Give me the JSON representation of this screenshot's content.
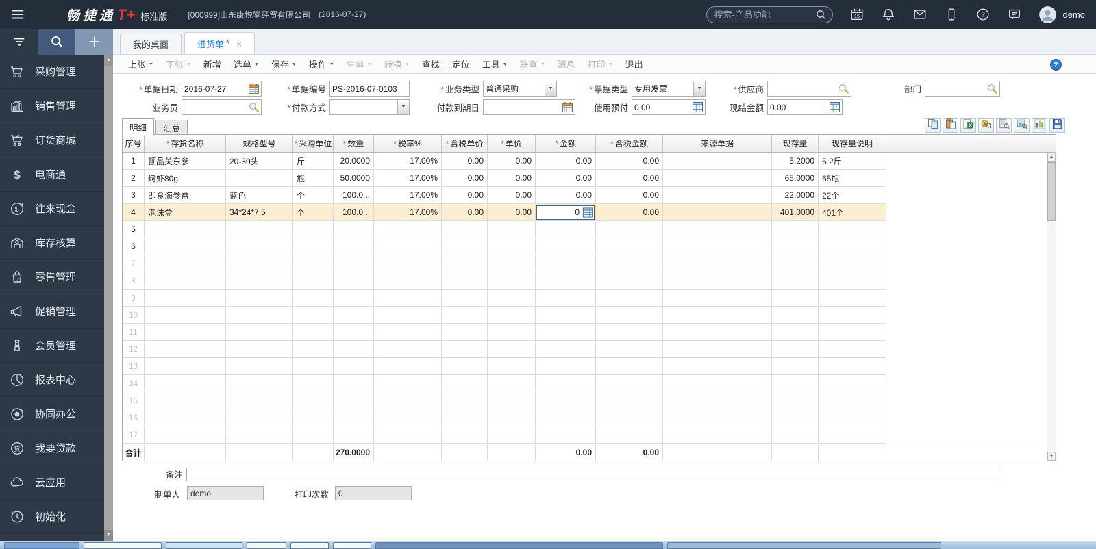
{
  "topbar": {
    "logo_cn": "畅捷通",
    "logo_plus": "T+",
    "edition": "标准版",
    "company": "[000999]山东康悦堂经贸有限公司",
    "date": "(2016-07-27)",
    "search_placeholder": "搜索-产品功能",
    "icons": [
      "calendar",
      "bell",
      "mail",
      "mobile",
      "help",
      "chat"
    ],
    "user": "demo"
  },
  "sidebar": {
    "items": [
      {
        "key": "purchase",
        "icon": "cart",
        "label": "采购管理"
      },
      {
        "key": "sales",
        "icon": "chart",
        "label": "销售管理"
      },
      {
        "key": "mall",
        "icon": "mallcart",
        "label": "订货商城"
      },
      {
        "key": "ecommerce",
        "icon": "ecommerce",
        "label": "电商通"
      },
      {
        "key": "cash",
        "icon": "coin",
        "label": "往来现金"
      },
      {
        "key": "inventory",
        "icon": "warehouse",
        "label": "库存核算"
      },
      {
        "key": "retail",
        "icon": "bag",
        "label": "零售管理"
      },
      {
        "key": "promotion",
        "icon": "megaphone",
        "label": "促销管理"
      },
      {
        "key": "member",
        "icon": "badge",
        "label": "会员管理"
      },
      {
        "key": "report",
        "icon": "pie",
        "label": "报表中心"
      },
      {
        "key": "collab",
        "icon": "target",
        "label": "协同办公"
      },
      {
        "key": "loan",
        "icon": "loan",
        "label": "我要贷款"
      },
      {
        "key": "cloud",
        "icon": "cloud",
        "label": "云应用"
      },
      {
        "key": "init",
        "icon": "clock",
        "label": "初始化"
      }
    ]
  },
  "tabs": [
    {
      "label": "我的桌面",
      "marker": ""
    },
    {
      "label": "进货单",
      "marker": "*"
    }
  ],
  "toolbar": {
    "items": [
      {
        "key": "prev",
        "label": "上张",
        "caret": true,
        "enabled": true
      },
      {
        "key": "next",
        "label": "下张",
        "caret": true,
        "enabled": false
      },
      {
        "key": "add",
        "label": "新增",
        "caret": false,
        "enabled": true
      },
      {
        "key": "select-bill",
        "label": "选单",
        "caret": true,
        "enabled": true
      },
      {
        "key": "save",
        "label": "保存",
        "caret": true,
        "enabled": true
      },
      {
        "key": "action",
        "label": "操作",
        "caret": true,
        "enabled": true
      },
      {
        "key": "generate",
        "label": "生单",
        "caret": true,
        "enabled": false
      },
      {
        "key": "convert",
        "label": "转换",
        "caret": true,
        "enabled": false
      },
      {
        "key": "find",
        "label": "查找",
        "caret": false,
        "enabled": true
      },
      {
        "key": "locate",
        "label": "定位",
        "caret": false,
        "enabled": true
      },
      {
        "key": "tools",
        "label": "工具",
        "caret": true,
        "enabled": true
      },
      {
        "key": "linkquery",
        "label": "联查",
        "caret": true,
        "enabled": false
      },
      {
        "key": "message",
        "label": "消息",
        "caret": false,
        "enabled": false
      },
      {
        "key": "print",
        "label": "打印",
        "caret": true,
        "enabled": false
      },
      {
        "key": "exit",
        "label": "退出",
        "caret": false,
        "enabled": true
      }
    ]
  },
  "required_marker": "*",
  "form": {
    "fields": [
      {
        "key": "bill-date",
        "label": "单据日期",
        "required": true,
        "value": "2016-07-27",
        "icon": "calendar"
      },
      {
        "key": "bill-no",
        "label": "单据编号",
        "required": true,
        "value": "PS-2016-07-0103",
        "icon": "none"
      },
      {
        "key": "biz-type",
        "label": "业务类型",
        "required": true,
        "value": "普通采购",
        "icon": "dropdown"
      },
      {
        "key": "invoice-type",
        "label": "票据类型",
        "required": true,
        "value": "专用发票",
        "icon": "dropdown"
      },
      {
        "key": "supplier",
        "label": "供应商",
        "required": true,
        "value": "",
        "icon": "magnifier"
      },
      {
        "key": "department",
        "label": "部门",
        "required": false,
        "value": "",
        "icon": "magnifier"
      },
      {
        "key": "salesman",
        "label": "业务员",
        "required": false,
        "value": "",
        "icon": "magnifier"
      },
      {
        "key": "pay-method",
        "label": "付款方式",
        "required": true,
        "value": "",
        "icon": "dropdown"
      },
      {
        "key": "pay-due",
        "label": "付款到期日",
        "required": false,
        "value": "",
        "icon": "calendar"
      },
      {
        "key": "prepaid",
        "label": "使用预付",
        "required": false,
        "value": "0.00",
        "icon": "calc"
      },
      {
        "key": "cash-amount",
        "label": "现结金额",
        "required": false,
        "value": "0.00",
        "icon": "calc"
      }
    ]
  },
  "detail_tabs": [
    {
      "label": "明细",
      "active": true
    },
    {
      "label": "汇总",
      "active": false
    }
  ],
  "grid_toolbar": {
    "icons": [
      "copy",
      "paste",
      "excel",
      "find-money",
      "doc-preview",
      "pic-preview",
      "chart",
      "save"
    ]
  },
  "grid": {
    "columns": [
      {
        "key": "seq",
        "label": "序号",
        "required": false
      },
      {
        "key": "item-name",
        "label": "存货名称",
        "required": true
      },
      {
        "key": "spec",
        "label": "规格型号",
        "required": false
      },
      {
        "key": "unit",
        "label": "采购单位",
        "required": true
      },
      {
        "key": "qty",
        "label": "数量",
        "required": true
      },
      {
        "key": "tax-rate",
        "label": "税率%",
        "required": true
      },
      {
        "key": "price-taxed",
        "label": "含税单价",
        "required": true
      },
      {
        "key": "price",
        "label": "单价",
        "required": true
      },
      {
        "key": "amount",
        "label": "金额",
        "required": true
      },
      {
        "key": "amount-taxed",
        "label": "含税金额",
        "required": true
      },
      {
        "key": "source",
        "label": "来源单据",
        "required": false
      },
      {
        "key": "stock",
        "label": "现存量",
        "required": false
      },
      {
        "key": "stock-desc",
        "label": "现存量说明",
        "required": false
      }
    ],
    "rows": [
      {
        "cells": [
          "1",
          "顶品关东参",
          "20-30头",
          "斤",
          "20.0000",
          "17.00%",
          "0.00",
          "0.00",
          "0.00",
          "0.00",
          "",
          "5.2000",
          "5.2斤"
        ],
        "selected": false
      },
      {
        "cells": [
          "2",
          "烤虾80g",
          "",
          "瓶",
          "50.0000",
          "17.00%",
          "0.00",
          "0.00",
          "0.00",
          "0.00",
          "",
          "65.0000",
          "65瓶"
        ],
        "selected": false
      },
      {
        "cells": [
          "3",
          "即食海参盒",
          "蓝色",
          "个",
          "100.0...",
          "17.00%",
          "0.00",
          "0.00",
          "0.00",
          "0.00",
          "",
          "22.0000",
          "22个"
        ],
        "selected": false
      },
      {
        "cells": [
          "4",
          "泡沫盒",
          "34*24*7.5",
          "个",
          "100.0...",
          "17.00%",
          "0.00",
          "0.00",
          "0",
          "0.00",
          "",
          "401.0000",
          "401个"
        ],
        "selected": true
      }
    ],
    "editor_cell": {
      "row": 3,
      "col": 8
    },
    "empty_rows": [
      {
        "num": "5",
        "dim": false
      },
      {
        "num": "6",
        "dim": false
      },
      {
        "num": "7",
        "dim": true
      },
      {
        "num": "8",
        "dim": true
      },
      {
        "num": "9",
        "dim": true
      },
      {
        "num": "10",
        "dim": true
      },
      {
        "num": "11",
        "dim": true
      },
      {
        "num": "12",
        "dim": true
      },
      {
        "num": "13",
        "dim": true
      },
      {
        "num": "14",
        "dim": true
      },
      {
        "num": "15",
        "dim": true
      },
      {
        "num": "16",
        "dim": true
      },
      {
        "num": "17",
        "dim": true
      }
    ],
    "total_row": [
      "合计",
      "",
      "",
      "",
      "270.0000",
      "",
      "",
      "",
      "0.00",
      "0.00",
      "",
      "",
      ""
    ]
  },
  "footer": {
    "remark_label": "备注",
    "remark_value": "",
    "maker_label": "制单人",
    "maker_value": "demo",
    "print_label": "打印次数",
    "print_value": "0"
  },
  "colors": {
    "topbar_bg": "#242d3a",
    "sidebar_bg": "#2d3947",
    "accent_red": "#e23c32",
    "active_tab_text": "#2a8ada",
    "selected_row_bg": "#fbeed3"
  }
}
